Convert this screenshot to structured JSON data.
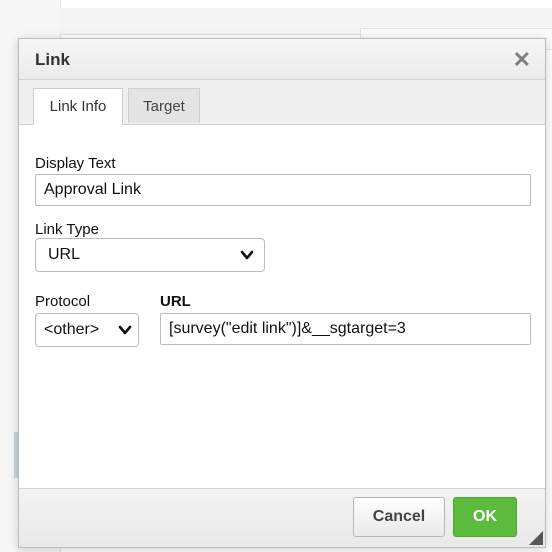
{
  "dialog": {
    "title": "Link",
    "close_icon": "close-icon"
  },
  "tabs": [
    {
      "label": "Link Info",
      "active": true
    },
    {
      "label": "Target",
      "active": false
    }
  ],
  "form": {
    "display_text_label": "Display Text",
    "display_text_value": "Approval Link",
    "link_type_label": "Link Type",
    "link_type_value": "URL",
    "protocol_label": "Protocol",
    "protocol_value": "<other>",
    "url_label": "URL",
    "url_value": "[survey(\"edit link\")]&__sgtarget=3"
  },
  "buttons": {
    "cancel": "Cancel",
    "ok": "OK"
  },
  "colors": {
    "ok_green": "#5cbb3c"
  }
}
